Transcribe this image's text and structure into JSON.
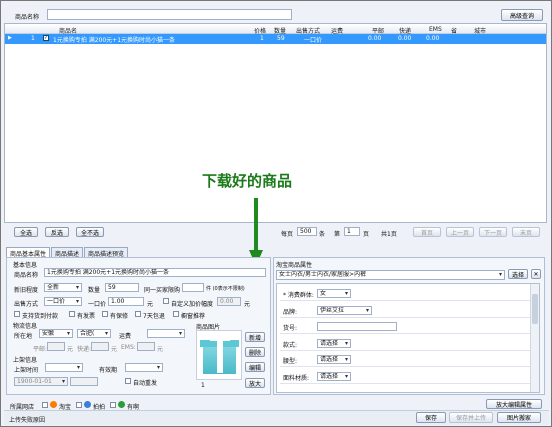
{
  "search": {
    "label": "商品名称",
    "value": "",
    "button": "高级查询"
  },
  "table": {
    "columns": [
      "商品名",
      "价格",
      "数量",
      "出售方式",
      "运费",
      "平邮",
      "快递",
      "EMS",
      "省",
      "城市"
    ],
    "row": {
      "marker": "▶",
      "index": "1",
      "name": "1元换购专拍 满200元+1元换购时尚小猫一条",
      "price": "1",
      "qty": "59",
      "sale": "一口价",
      "freight": "",
      "ping": "0.00",
      "express": "0.00",
      "ems": "0.00",
      "province": "",
      "city": ""
    }
  },
  "overlay": {
    "text": "下载好的商品"
  },
  "pager": {
    "select_all": "全选",
    "invert": "反选",
    "select_none": "全不选",
    "per_page_label": "每页",
    "per_page_value": "500",
    "unit": "条",
    "page_prefix": "第",
    "page_value": "1",
    "page_suffix": "页",
    "total": "共1页",
    "first": "首页",
    "prev": "上一页",
    "next": "下一页",
    "last": "末页"
  },
  "tabs": [
    "商品基本属性",
    "商品描述",
    "商品描述预览"
  ],
  "basic": {
    "section": "基本信息",
    "name_label": "商品名称",
    "name_value": "1元换购专拍 满200元+1元换购时尚小猫一条",
    "condition_label": "新旧程度",
    "condition_value": "全新",
    "qty_label": "数量",
    "qty_value": "59",
    "limit_label": "同一买家限购",
    "limit_value": "",
    "limit_suffix": "件 (0表示不限制)",
    "sale_label": "出售方式",
    "sale_value": "一口价",
    "price_label": "一口价",
    "price_value": "1.00",
    "price_unit": "元",
    "custom_label": "自定义加价幅度",
    "custom_value": "0.00",
    "custom_unit": "元",
    "opt1": "支持货到付款",
    "opt2": "有发票",
    "opt3": "有保修",
    "opt4": "7天包退",
    "opt5": "橱窗推荐",
    "logistics": "物流信息",
    "location_label": "所在地",
    "province": "安徽",
    "city": "合肥(",
    "freight_label": "运费",
    "ping_label": "平邮:",
    "express_label": "快递:",
    "ems_label": "EMS:",
    "freight_unit": "元",
    "shelf": "上架信息",
    "shelf_time_label": "上架时间",
    "valid_label": "有效期",
    "date_value": "1900-01-01",
    "auto_relist": "自动重发",
    "image_label": "商品图片",
    "image_index": "1",
    "img_btn_new": "新增",
    "img_btn_delete": "删除",
    "img_btn_edit": "编辑",
    "img_btn_zoom": "放大"
  },
  "taobao": {
    "header": "淘宝商品属性",
    "category": "女士内衣/男士内衣/家居服>内裤",
    "choose": "选择",
    "props": [
      {
        "label": "* 消费群体:",
        "value": "女",
        "type": "select"
      },
      {
        "label": "品牌:",
        "value": "伊丝艾拉",
        "type": "select"
      },
      {
        "label": "货号:",
        "value": "",
        "type": "text"
      },
      {
        "label": "款式:",
        "value": "请选择",
        "type": "select"
      },
      {
        "label": "腰型:",
        "value": "请选择",
        "type": "select"
      },
      {
        "label": "面料材质:",
        "value": "请选择",
        "type": "select"
      }
    ]
  },
  "footer": {
    "site_label": "所属网店",
    "site1": "淘宝",
    "site2": "拍拍",
    "site3": "有啊",
    "zoom_edit": "放大编辑属性",
    "status": "上传失败原因",
    "save": "保存",
    "save_upload": "保存并上传",
    "move_img": "图片搬家"
  },
  "colors": {
    "accent": "#3399ff",
    "overlay_text": "#1a7a1a",
    "arrow": "#1f8a1f"
  }
}
